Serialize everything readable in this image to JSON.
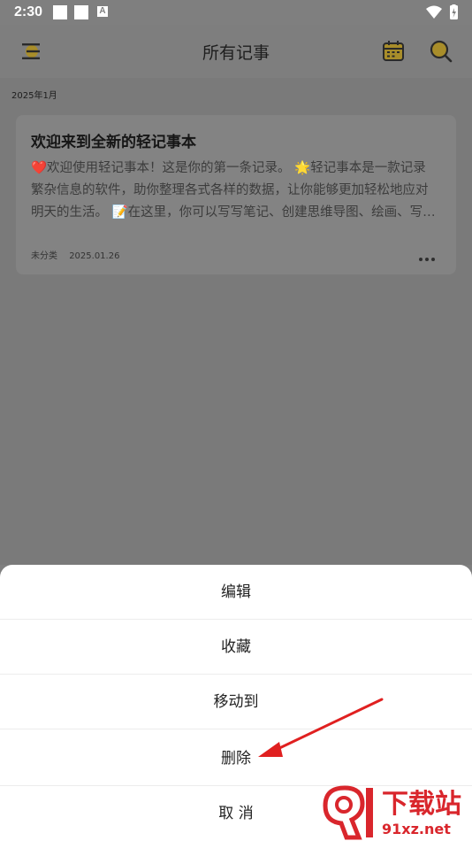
{
  "status_bar": {
    "time": "2:30",
    "icons": [
      "square-notification-icon",
      "square-notification-icon",
      "a-notification-icon",
      "wifi-icon",
      "battery-charging-icon"
    ]
  },
  "header": {
    "title": "所有记事",
    "icons": [
      "menu-icon",
      "calendar-icon",
      "search-icon"
    ]
  },
  "list": {
    "month": "2025年1月",
    "notes": [
      {
        "title": "欢迎来到全新的轻记事本",
        "lines": [
          "❤️欢迎使用轻记事本！这是你的第一条记录。 🌟轻记事本是一款记录",
          "繁杂信息的软件，助你整理各式各样的数据，让你能够更加轻松地应对",
          "明天的生活。 📝在这里，你可以写写笔记、创建思维导图、绘画、写…"
        ],
        "category": "未分类",
        "date": "2025.01.26"
      }
    ]
  },
  "action_sheet": {
    "items": [
      "编辑",
      "收藏",
      "移动到",
      "删除",
      "取 消"
    ]
  },
  "watermark": {
    "brand": "下载站",
    "domain": "91xz.net"
  },
  "colors": {
    "overlay": "#7f7f7f",
    "arrow": "#e02020",
    "watermark": "#d9262c",
    "accent": "#f2c200"
  }
}
